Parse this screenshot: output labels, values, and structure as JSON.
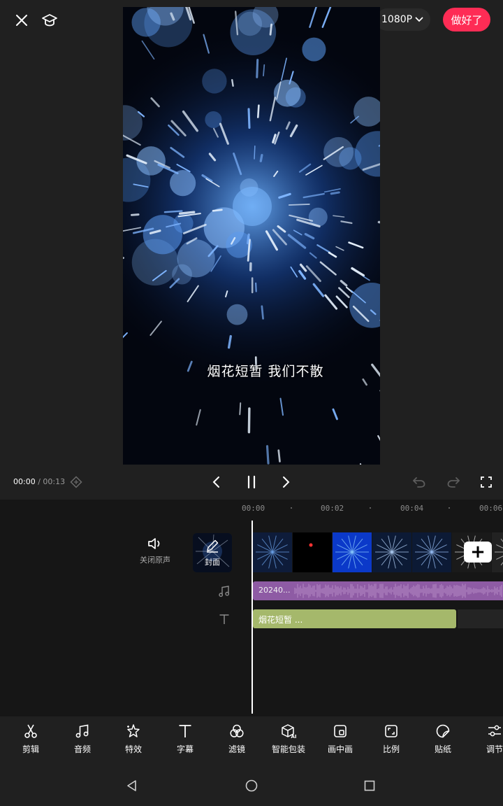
{
  "top_bar": {
    "resolution": "1080P",
    "done_label": "做好了"
  },
  "preview": {
    "subtitle": "烟花短暂   我们不散"
  },
  "playback": {
    "current_time": "00:00",
    "separator": " / ",
    "total_time": "00:13"
  },
  "timeline": {
    "ticks": [
      "00:00",
      "00:02",
      "00:04",
      "00:06"
    ],
    "mute_label": "关闭原声",
    "cover_label": "封面",
    "audio_clip_label": "20240...",
    "text_clip_label": "烟花短暂 ..."
  },
  "toolbar": {
    "items": [
      {
        "label": "剪辑",
        "icon": "scissors-icon"
      },
      {
        "label": "音频",
        "icon": "music-note-icon"
      },
      {
        "label": "特效",
        "icon": "sparkle-star-icon"
      },
      {
        "label": "字幕",
        "icon": "text-t-icon"
      },
      {
        "label": "滤镜",
        "icon": "filter-circles-icon"
      },
      {
        "label": "智能包装",
        "icon": "ai-package-icon"
      },
      {
        "label": "画中画",
        "icon": "picture-in-picture-icon"
      },
      {
        "label": "比例",
        "icon": "aspect-ratio-icon"
      },
      {
        "label": "贴纸",
        "icon": "sticker-icon"
      },
      {
        "label": "调节",
        "icon": "adjust-sliders-icon"
      }
    ]
  },
  "colors": {
    "accent": "#fe2c55",
    "audio_clip": "#8e5ba4",
    "text_clip": "#a5b86b",
    "background": "#202020"
  }
}
